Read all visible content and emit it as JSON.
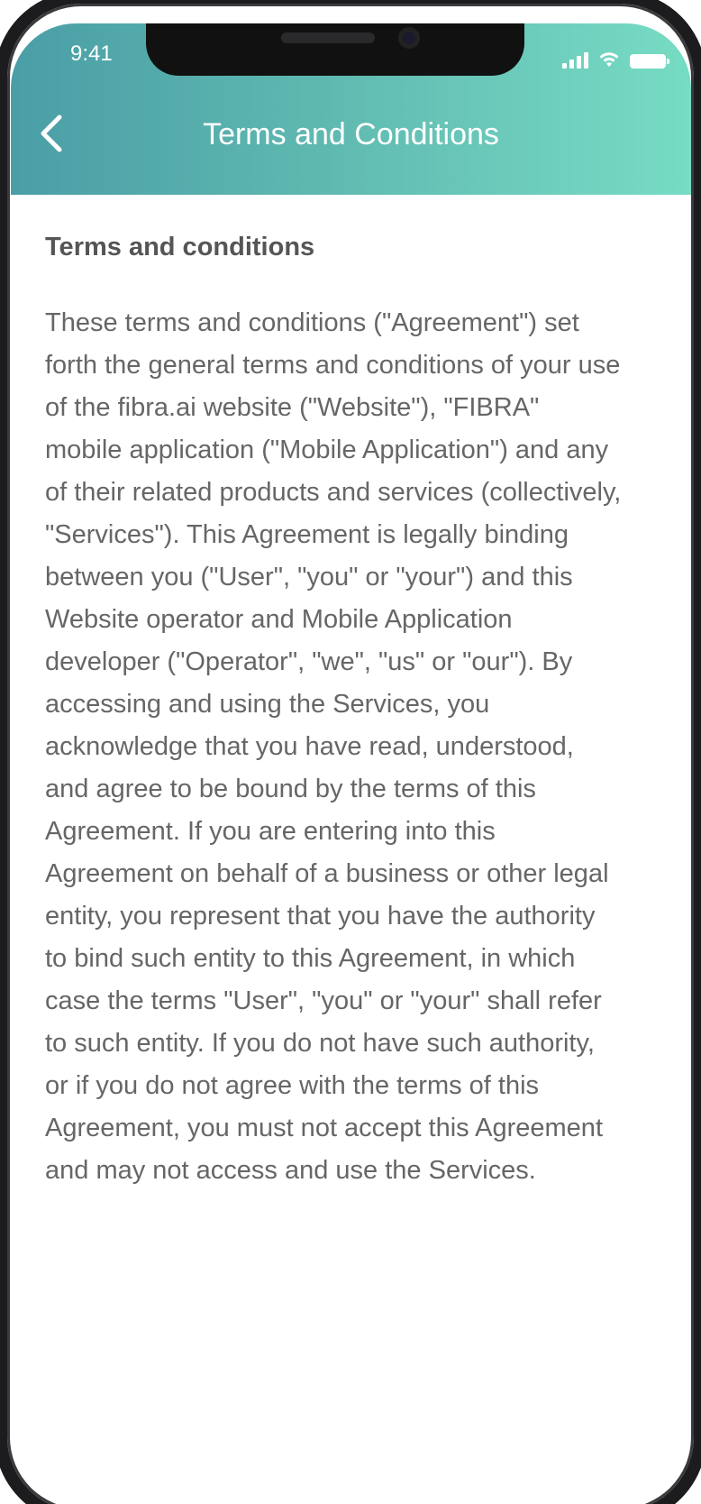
{
  "status_bar": {
    "time": "9:41"
  },
  "header": {
    "title": "Terms and Conditions",
    "back_icon": "chevron-left-icon",
    "gradient": [
      "#4a9ea6",
      "#77dcc4"
    ]
  },
  "content": {
    "heading": "Terms and conditions",
    "body": "These terms and conditions (\"Agreement\") set forth the general terms and conditions of your use of the fibra.ai website (\"Website\"), \"FIBRA\" mobile application (\"Mobile Application\") and any of their related products and services (collectively, \"Services\"). This Agreement is legally binding between you (\"User\", \"you\" or \"your\") and this Website operator and Mobile Application developer (\"Operator\", \"we\", \"us\" or \"our\"). By accessing and using the Services, you acknowledge that you have read, understood, and agree to be bound by the terms of this Agreement. If you are entering into this Agreement on behalf of a business or other legal entity, you represent that you have the authority to bind such entity to this Agreement, in which case the terms \"User\", \"you\" or \"your\" shall refer to such entity. If you do not have such authority, or if you do not agree with the terms of this Agreement, you must not accept this Agreement and may not access and use the Services."
  }
}
